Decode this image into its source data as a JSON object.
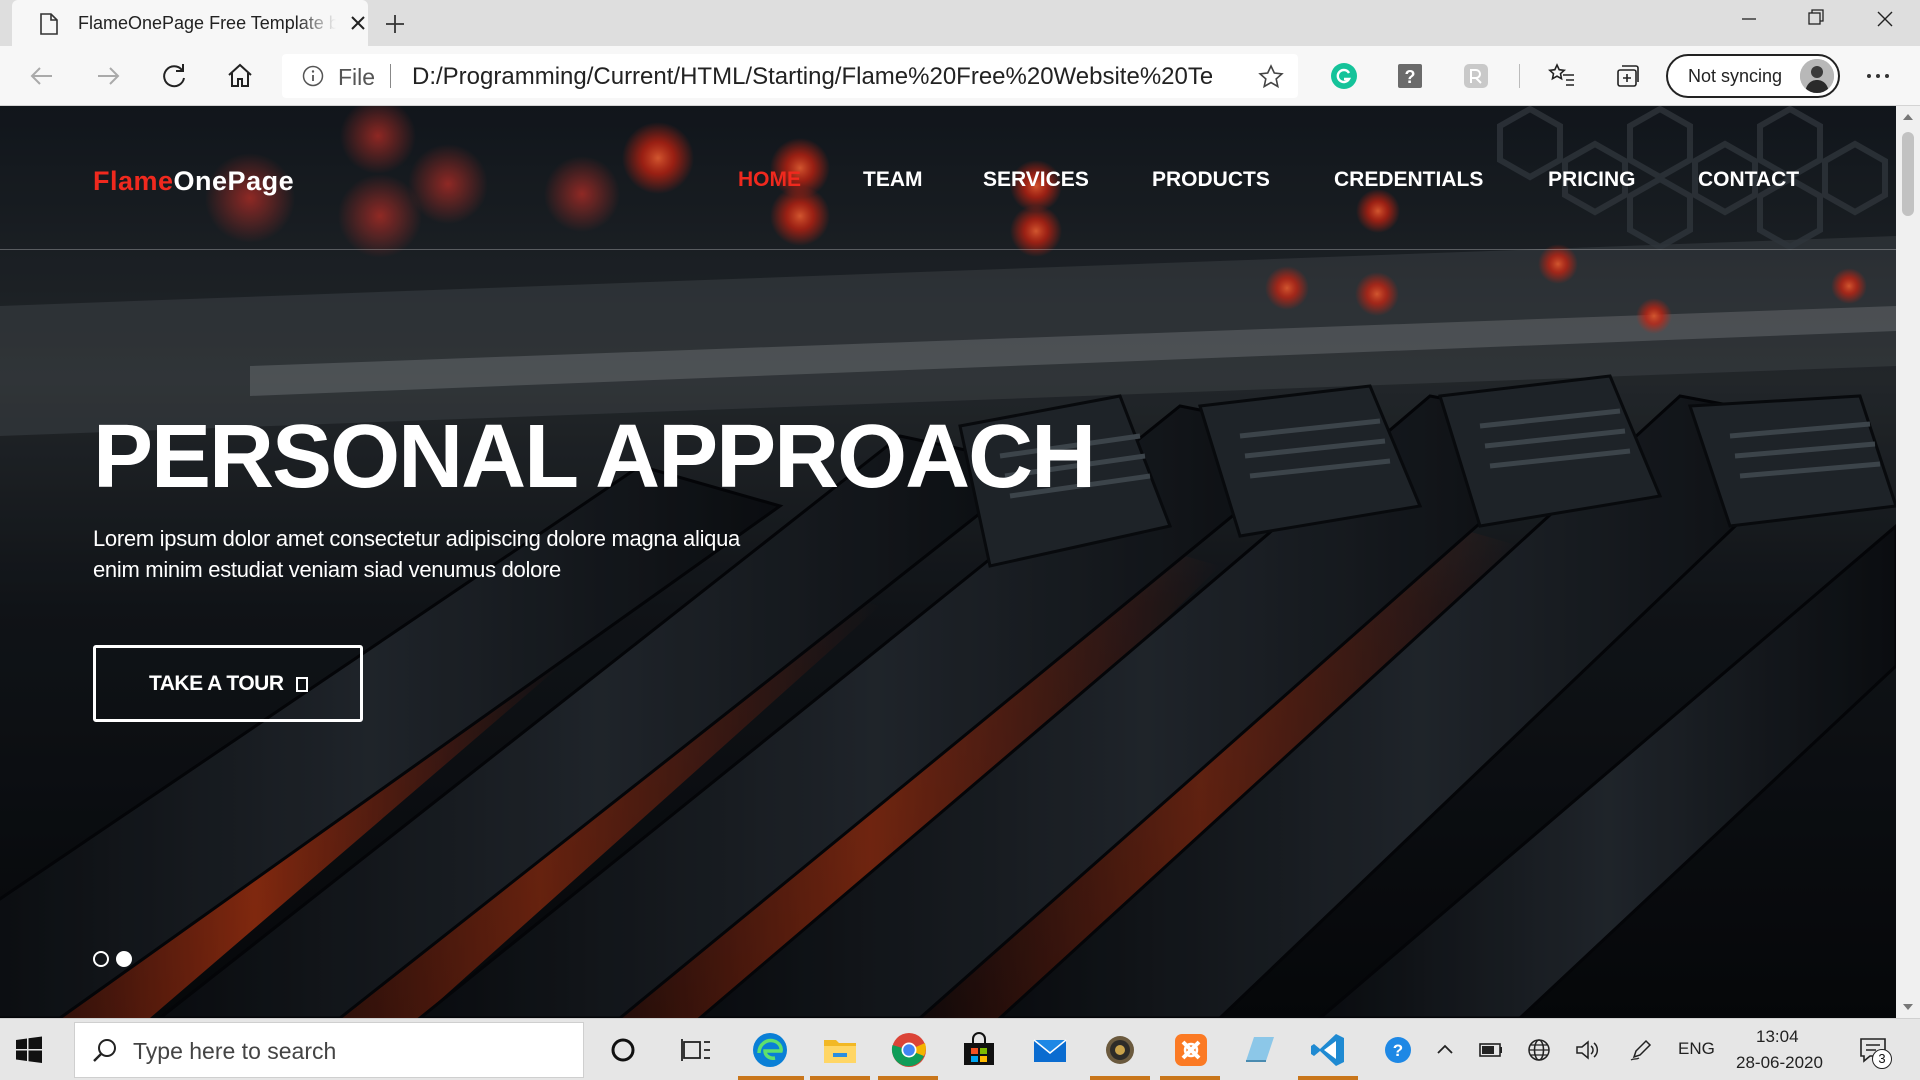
{
  "browser": {
    "tab_title": "FlameOnePage Free Template by",
    "address": {
      "scheme_label": "File",
      "url": "D:/Programming/Current/HTML/Starting/Flame%20Free%20Website%20Te..."
    },
    "sync_label": "Not syncing"
  },
  "site": {
    "brand_part1": "Flame",
    "brand_part2": "OnePage",
    "nav": [
      {
        "label": "HOME",
        "active": true
      },
      {
        "label": "TEAM"
      },
      {
        "label": "SERVICES"
      },
      {
        "label": "PRODUCTS"
      },
      {
        "label": "CREDENTIALS"
      },
      {
        "label": "PRICING"
      },
      {
        "label": "CONTACT"
      }
    ],
    "hero": {
      "title": "PERSONAL APPROACH",
      "text_line1": "Lorem ipsum dolor amet consectetur adipiscing dolore magna aliqua",
      "text_line2": "enim minim estudiat veniam siad venumus dolore",
      "cta_label": "TAKE A TOUR",
      "slides_total": 2,
      "slide_active": 2
    }
  },
  "taskbar": {
    "search_placeholder": "Type here to search",
    "language": "ENG",
    "time": "13:04",
    "date": "28-06-2020",
    "notification_count": "3"
  },
  "colors": {
    "accent_red": "#f0291e",
    "edge_blue": "#0a7fd6",
    "grammarly_green": "#15c39a",
    "vscode_blue": "#1f8ad2",
    "xampp_orange": "#fb7a24"
  },
  "icons": [
    "page-icon",
    "close-icon",
    "plus-icon",
    "minimize-icon",
    "restore-icon",
    "back-arrow-icon",
    "forward-arrow-icon",
    "refresh-icon",
    "home-icon",
    "info-icon",
    "star-icon",
    "grammarly-icon",
    "help-icon",
    "extension-icon",
    "favorites-icon",
    "collections-icon",
    "more-icon",
    "windows-logo-icon",
    "search-icon",
    "cortana-icon",
    "task-view-icon",
    "edge-icon",
    "file-explorer-icon",
    "chrome-icon",
    "store-icon",
    "mail-icon",
    "settings-gear-icon",
    "xampp-icon",
    "notepad-icon",
    "vscode-icon",
    "help-tray-icon",
    "chevron-up-icon",
    "battery-icon",
    "globe-icon",
    "volume-icon",
    "pen-icon",
    "notification-icon"
  ]
}
